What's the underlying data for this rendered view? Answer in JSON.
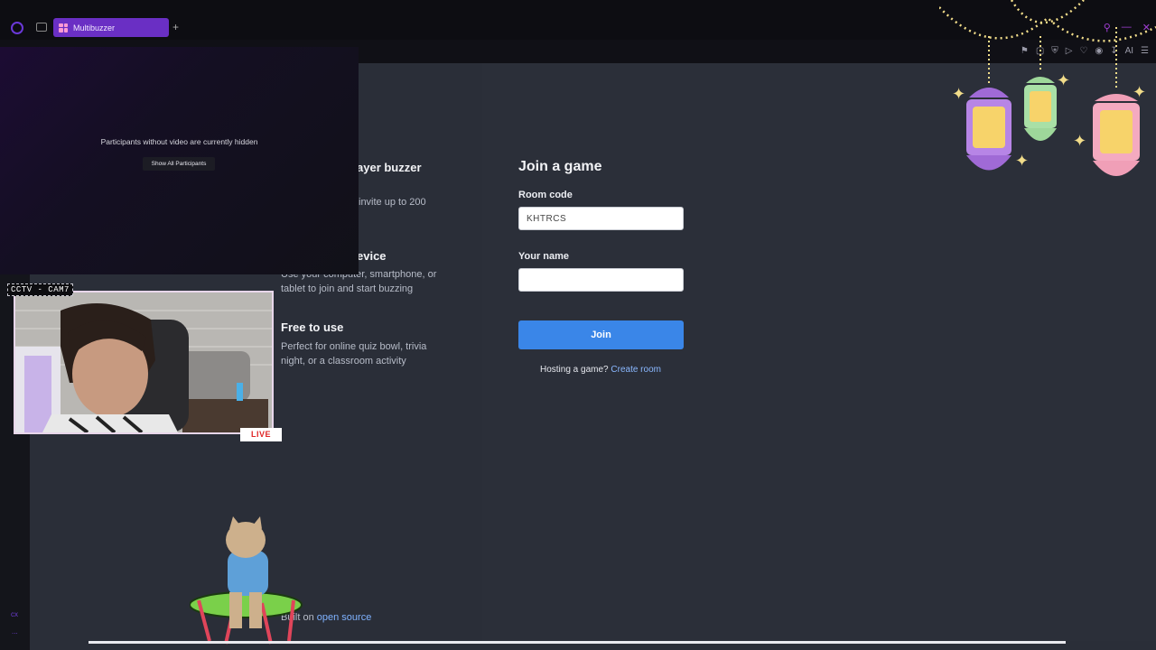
{
  "browser": {
    "tab_title": "Multibuzzer",
    "new_tab": "+",
    "window_controls": [
      "search-icon",
      "minimize-icon",
      "close-icon"
    ],
    "toolbar_ai": "AI"
  },
  "features": {
    "item1_title": "ayer buzzer",
    "item1_text": "invite up to 200",
    "item2_title": "evice",
    "item2_text": "Use your computer, smartphone, or tablet to join and start buzzing",
    "item3_title": "Free to use",
    "item3_text": "Perfect for online quiz bowl, trivia night, or a classroom activity"
  },
  "footer": {
    "built_prefix": "Built on",
    "built_link": "open source"
  },
  "join": {
    "title": "Join a game",
    "room_label": "Room code",
    "room_value": "KHTRCS",
    "name_label": "Your name",
    "name_value": "",
    "join_button": "Join",
    "hosting_prefix": "Hosting a game?",
    "create_link": "Create room"
  },
  "participants": {
    "message": "Participants without video are currently hidden",
    "show_all": "Show All Participants"
  },
  "webcam": {
    "label": "CCTV - CAM7",
    "live_badge": "LIVE"
  },
  "sidebar": {
    "bottom1": "cx",
    "bottom2": "..."
  },
  "colors": {
    "accent": "#6a2fc4",
    "join_button": "#3a86e8",
    "link": "#7fb2ff",
    "background": "#2a2e38"
  }
}
